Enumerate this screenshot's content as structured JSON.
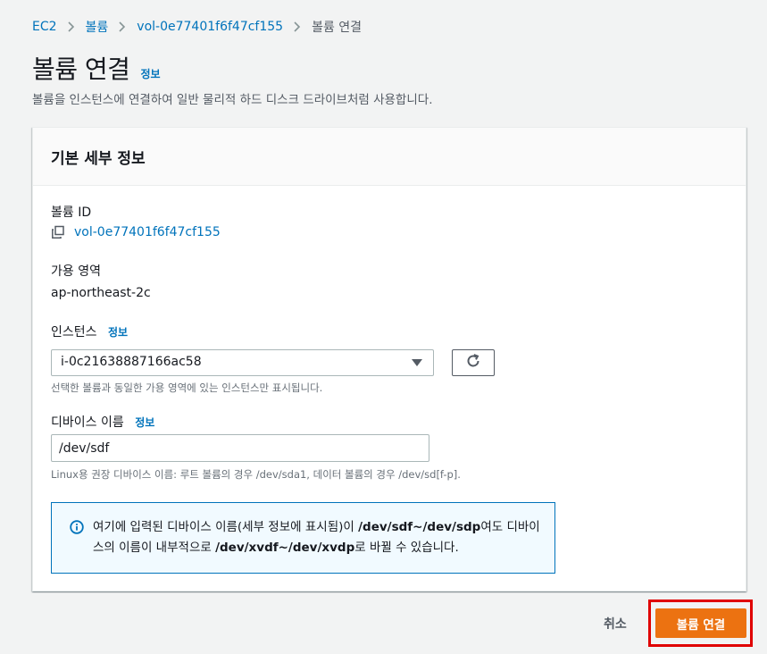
{
  "breadcrumb": {
    "items": [
      "EC2",
      "볼륨",
      "vol-0e77401f6f47cf155"
    ],
    "current": "볼륨 연결"
  },
  "page": {
    "title": "볼륨 연결",
    "info": "정보",
    "description": "볼륨을 인스턴스에 연결하여 일반 물리적 하드 디스크 드라이브처럼 사용합니다."
  },
  "panel": {
    "header": "기본 세부 정보",
    "volume_id_label": "볼륨 ID",
    "volume_id_value": "vol-0e77401f6f47cf155",
    "az_label": "가용 영역",
    "az_value": "ap-northeast-2c",
    "instance_label": "인스턴스",
    "instance_info": "정보",
    "instance_value": "i-0c21638887166ac58",
    "instance_hint": "선택한 볼륨과 동일한 가용 영역에 있는 인스턴스만 표시됩니다.",
    "device_label": "디바이스 이름",
    "device_info": "정보",
    "device_value": "/dev/sdf",
    "device_hint": "Linux용 권장 디바이스 이름: 루트 볼륨의 경우 /dev/sda1, 데이터 볼륨의 경우 /dev/sd[f-p].",
    "alert": {
      "part1": "여기에 입력된 디바이스 이름(세부 정보에 표시됨)이 ",
      "bold1": "/dev/sdf~/dev/sdp",
      "part2": "여도 디바이스의 이름이 내부적으로 ",
      "bold2": "/dev/xvdf~/dev/xvdp",
      "part3": "로 바뀔 수 있습니다."
    }
  },
  "footer": {
    "cancel": "취소",
    "submit": "볼륨 연결"
  },
  "colors": {
    "link": "#0073bb",
    "primary": "#ec7211",
    "highlight": "#e00000"
  }
}
